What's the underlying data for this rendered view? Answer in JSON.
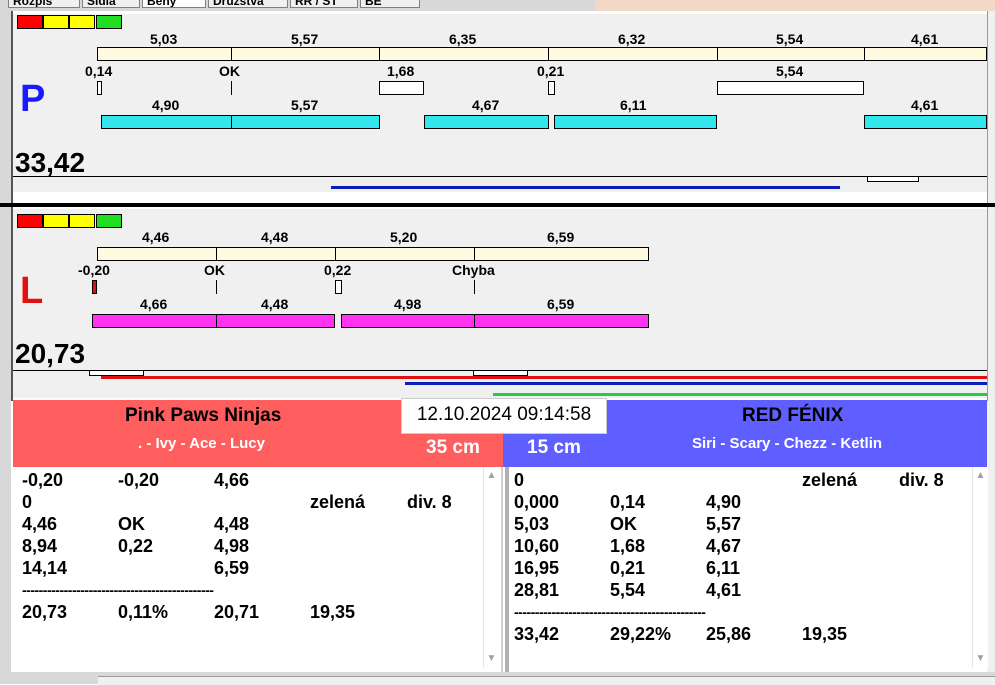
{
  "tabs": [
    {
      "label": "Rozpis"
    },
    {
      "label": "Sídla"
    },
    {
      "label": "Běhy"
    },
    {
      "label": "Družstva"
    },
    {
      "label": "RR / ST"
    },
    {
      "label": "BE"
    }
  ],
  "top_track": {
    "letter": "P",
    "letter_color": "#1a1aff",
    "total": "33,42",
    "cream_labels": [
      "5,03",
      "5,57",
      "6,35",
      "6,32",
      "5,54",
      "4,61"
    ],
    "mid_labels": [
      "0,14",
      "OK",
      "1,68",
      "0,21",
      "5,54"
    ],
    "cyan_labels": [
      "4,90",
      "5,57",
      "4,67",
      "6,11",
      "4,61"
    ]
  },
  "bottom_track": {
    "letter": "L",
    "letter_color": "#e01010",
    "total": "20,73",
    "cream_labels": [
      "4,46",
      "4,48",
      "5,20",
      "6,59"
    ],
    "mid_labels": [
      "-0,20",
      "OK",
      "0,22",
      "Chyba"
    ],
    "magenta_labels": [
      "4,66",
      "4,48",
      "4,98",
      "6,59"
    ]
  },
  "colors": {
    "traffic": [
      "#ff0000",
      "#ffff00",
      "#ffff00",
      "#22dd22"
    ],
    "cyan": "#33e6ec",
    "magenta": "#ff33f0",
    "left_team_bg": "#ff5e5e",
    "right_team_bg": "#5f5fff",
    "progress_blue": "#0b1fb8",
    "progress_red": "#e01010",
    "progress_green": "#22cc44"
  },
  "datetime": "12.10.2024 09:14:58",
  "left_team": {
    "name": "Pink Paws Ninjas",
    "members": ". - Ivy - Ace - Lucy",
    "distance": "35 cm",
    "rows": [
      [
        "-0,20",
        "-0,20",
        "4,66",
        "",
        ""
      ],
      [
        "0",
        "",
        "",
        "zelená",
        "div. 8"
      ],
      [
        "4,46",
        "OK",
        "4,48",
        "",
        ""
      ],
      [
        "8,94",
        "0,22",
        "4,98",
        "",
        ""
      ],
      [
        "14,14",
        "",
        "6,59",
        "",
        ""
      ]
    ],
    "separator": "----------------------------------------------",
    "summary": [
      "20,73",
      "0,11%",
      "20,71",
      "19,35"
    ]
  },
  "right_team": {
    "name": "RED FÉNIX",
    "members": "Siri - Scary - Chezz - Ketlin",
    "distance": "15 cm",
    "rows": [
      [
        "0",
        "",
        "",
        "zelená",
        "div. 8"
      ],
      [
        "0,000",
        "0,14",
        "4,90",
        "",
        ""
      ],
      [
        "5,03",
        "OK",
        "5,57",
        "",
        ""
      ],
      [
        "10,60",
        "1,68",
        "4,67",
        "",
        ""
      ],
      [
        "16,95",
        "0,21",
        "6,11",
        "",
        ""
      ],
      [
        "28,81",
        "5,54",
        "4,61",
        "",
        ""
      ]
    ],
    "separator": "----------------------------------------------",
    "summary": [
      "33,42",
      "29,22%",
      "25,86",
      "19,35"
    ]
  },
  "icons": {
    "scroll_up": "▲",
    "scroll_down": "▼"
  }
}
